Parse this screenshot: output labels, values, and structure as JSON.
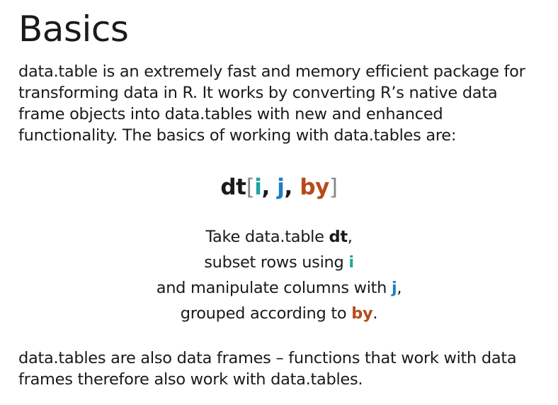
{
  "title": "Basics",
  "intro": "data.table is an extremely fast and memory efficient package for transforming data in R. It works by converting R’s native data frame objects into data.tables with new and enhanced functionality. The basics of working with data.tables are:",
  "syntax": {
    "name": "dt",
    "open_bracket": "[",
    "i": "i",
    "sep1": ", ",
    "j": "j",
    "sep2": ", ",
    "by": "by",
    "close_bracket": "]"
  },
  "explanation": {
    "line1_prefix": "Take data.table ",
    "line1_term": "dt",
    "line1_suffix": ",",
    "line2_prefix": "subset rows using ",
    "line2_term": "i",
    "line3_prefix": "and manipulate columns with ",
    "line3_term": "j",
    "line3_suffix": ",",
    "line4_prefix": "grouped according to ",
    "line4_term": "by",
    "line4_suffix": "."
  },
  "outro": "data.tables are also data frames – functions that work with data frames therefore also work with data.tables.",
  "colors": {
    "i": "#20a39e",
    "j": "#1a7fc4",
    "by": "#b84a1a",
    "bracket": "#888888",
    "text": "#1a1a1a"
  }
}
